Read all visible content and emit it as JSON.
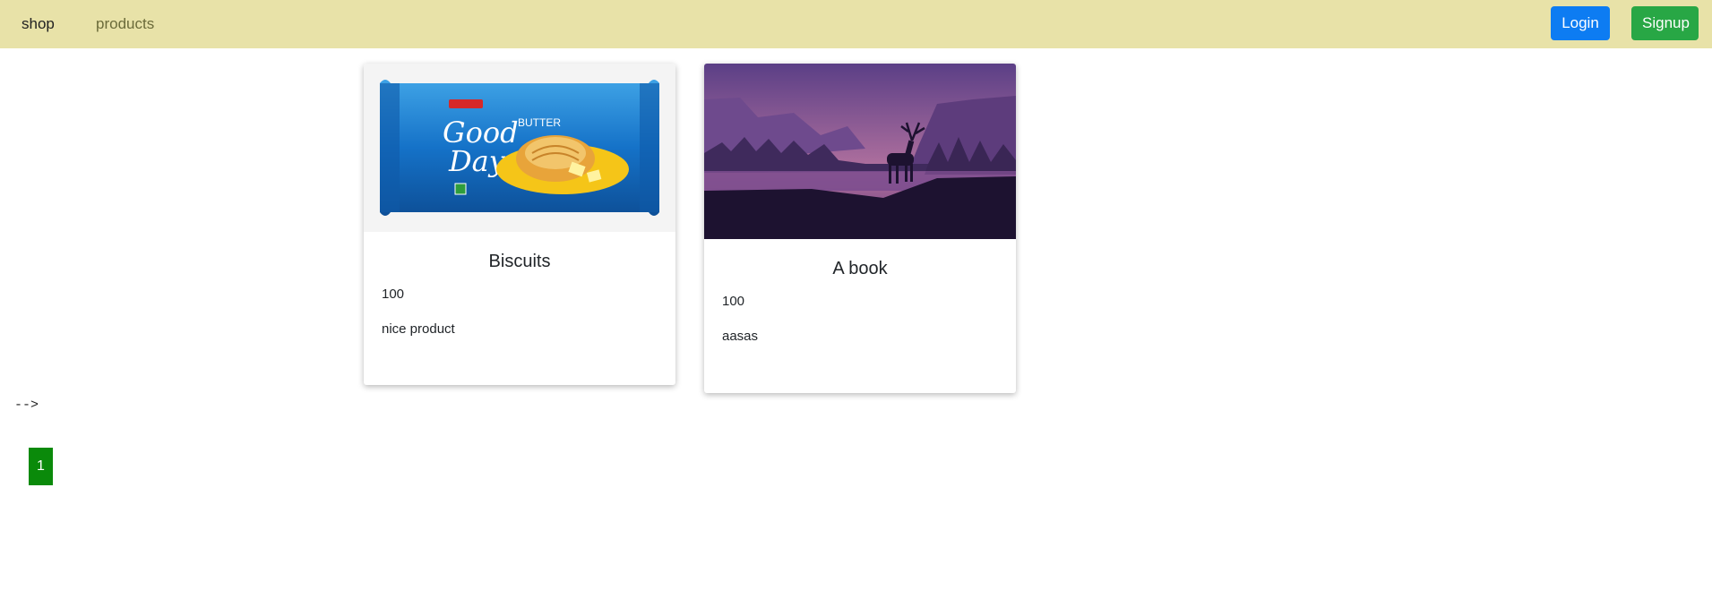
{
  "navbar": {
    "brand": "shop",
    "links": [
      "products"
    ],
    "login_label": "Login",
    "signup_label": "Signup"
  },
  "products": [
    {
      "title": "Biscuits",
      "price": "100",
      "description": "nice product",
      "image": "biscuit-pack-image"
    },
    {
      "title": "A book",
      "price": "100",
      "description": "aasas",
      "image": "deer-landscape-image"
    }
  ],
  "page_text": {
    "comment_residue": "-->"
  },
  "pagination": {
    "pages": [
      "1"
    ],
    "active_color": "#0a8a0a"
  },
  "colors": {
    "navbar_bg": "#e8e2a8",
    "login_bg": "#0d7cf2",
    "signup_bg": "#28a745"
  }
}
